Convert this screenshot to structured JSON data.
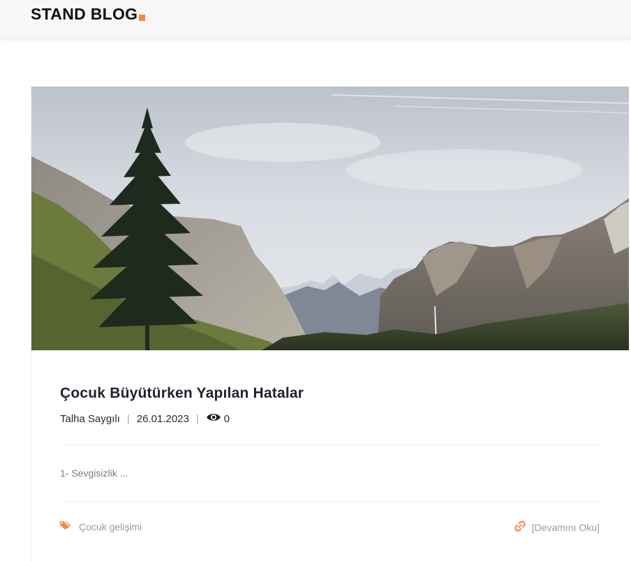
{
  "header": {
    "brand": "STAND BLOG",
    "brand_accent_color": "#f48840"
  },
  "post": {
    "image": "mountain-valley-landscape-with-pine-tree",
    "title": "Çocuk Büyütürken Yapılan Hatalar",
    "author": "Talha Saygılı",
    "date": "26.01.2023",
    "separator": "|",
    "views_icon": "eye-icon",
    "views": "0",
    "excerpt": "1- Sevgisizlik  ...",
    "category_icon": "tags-icon",
    "category": "Çocuk gelişimi",
    "read_more_icon": "link-icon",
    "read_more": "[Devamını Oku]"
  },
  "colors": {
    "accent": "#f48840",
    "title": "#20232e",
    "muted": "#9a9a9a"
  }
}
